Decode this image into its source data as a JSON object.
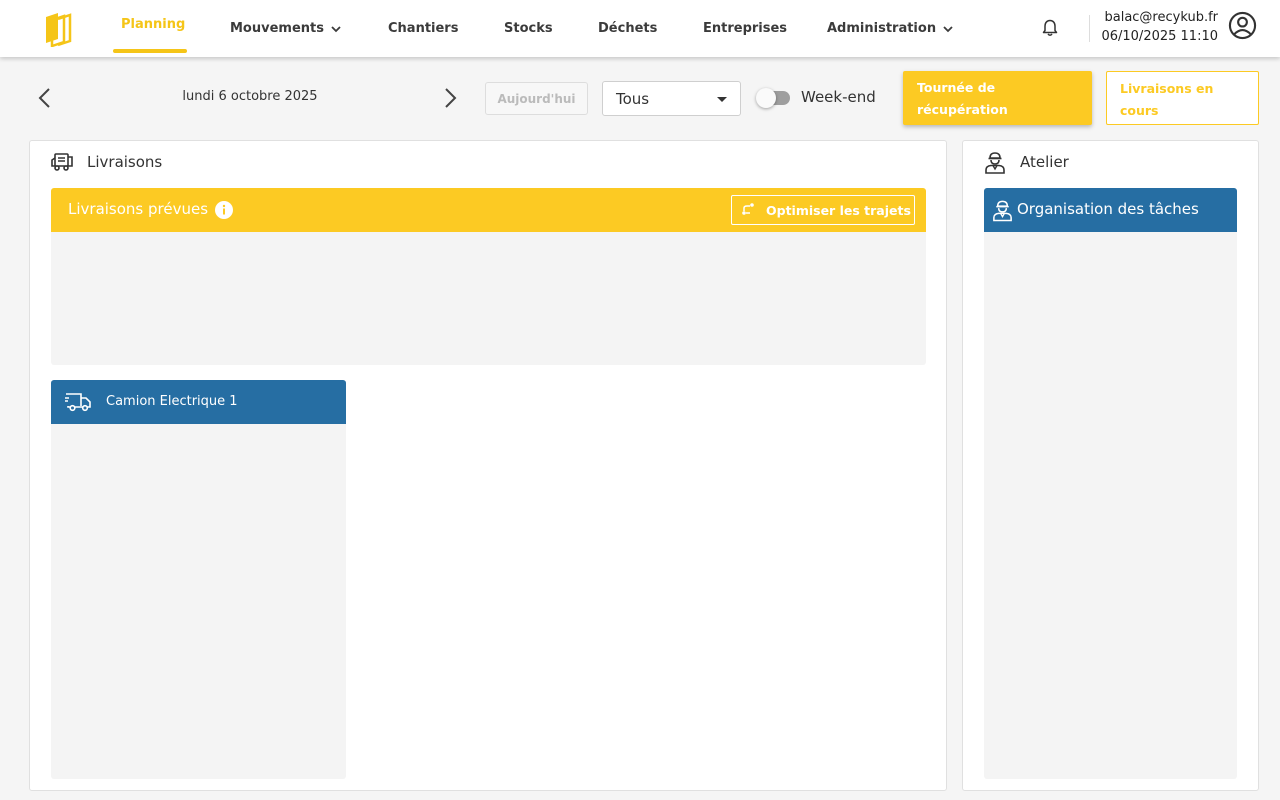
{
  "app": {
    "logo": "recykub-logo-icon"
  },
  "nav": {
    "items": [
      {
        "label": "Planning",
        "active": true
      },
      {
        "label": "Mouvements",
        "dropdown": true
      },
      {
        "label": "Chantiers"
      },
      {
        "label": "Stocks"
      },
      {
        "label": "Déchets"
      },
      {
        "label": "Entreprises"
      },
      {
        "label": "Administration",
        "dropdown": true
      }
    ]
  },
  "user": {
    "email": "balac@recykub.fr",
    "datetime": "06/10/2025 11:10"
  },
  "toolbar": {
    "date": "lundi 6 octobre 2025",
    "today_label": "Aujourd'hui",
    "filter_value": "Tous",
    "weekend_label": "Week-end",
    "weekend_on": false,
    "btn_tournee": "Tournée de récupération",
    "btn_livraisons_cours": "Livraisons en cours"
  },
  "livraisons": {
    "title": "Livraisons",
    "planned_title": "Livraisons prévues",
    "optimize_label": "Optimiser les trajets",
    "trucks": [
      {
        "name": "Camion Electrique 1"
      }
    ]
  },
  "atelier": {
    "title": "Atelier",
    "tasks_title": "Organisation des tâches"
  },
  "colors": {
    "accent": "#fcca23",
    "blue": "#266ea3",
    "nav_active": "#f5c518"
  }
}
